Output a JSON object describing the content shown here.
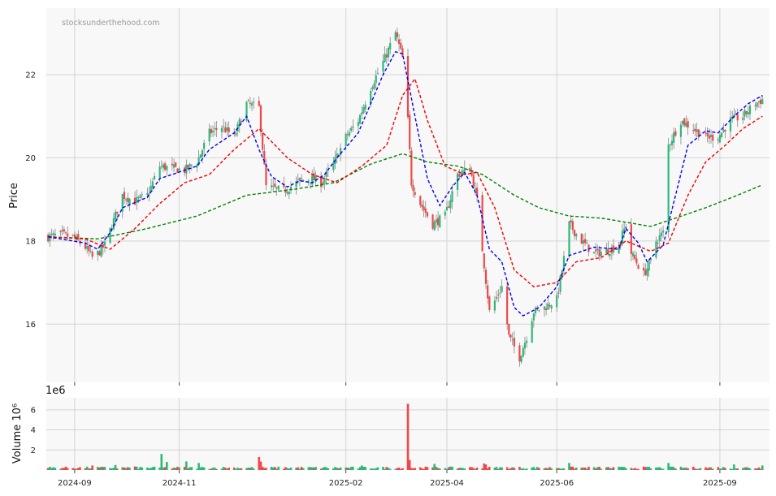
{
  "chart_data": [
    {
      "type": "candlestick",
      "panel": "price",
      "watermark": "stocksunderthehood.com",
      "ylabel": "Price",
      "ylim": [
        14.6,
        23.6
      ],
      "yticks": [
        16,
        18,
        20,
        22
      ],
      "xlim": [
        "2024-08-18",
        "2025-09-30"
      ],
      "grid": true,
      "colors": {
        "up": "#2db87a",
        "down": "#f04848",
        "ma_fast": "#0000ee",
        "ma_mid": "#ee0000",
        "ma_slow": "#008000",
        "background": "#f8f8f8",
        "grid": "#d4d4d4"
      },
      "anchors": [
        [
          "2024-08-19",
          18.1
        ],
        [
          "2024-08-26",
          18.15
        ],
        [
          "2024-09-02",
          18.1
        ],
        [
          "2024-09-09",
          17.85
        ],
        [
          "2024-09-13",
          17.6
        ],
        [
          "2024-09-16",
          17.7
        ],
        [
          "2024-09-20",
          17.9
        ],
        [
          "2024-09-25",
          18.5
        ],
        [
          "2024-09-30",
          19.1
        ],
        [
          "2024-10-07",
          18.95
        ],
        [
          "2024-10-14",
          19.1
        ],
        [
          "2024-10-21",
          19.8
        ],
        [
          "2024-10-28",
          19.75
        ],
        [
          "2024-11-04",
          19.7
        ],
        [
          "2024-11-11",
          19.9
        ],
        [
          "2024-11-18",
          20.6
        ],
        [
          "2024-11-25",
          20.75
        ],
        [
          "2024-12-02",
          20.5
        ],
        [
          "2024-12-09",
          21.3
        ],
        [
          "2024-12-16",
          21.2
        ],
        [
          "2024-12-20",
          19.3
        ],
        [
          "2024-12-30",
          19.2
        ],
        [
          "2025-01-08",
          19.45
        ],
        [
          "2025-01-15",
          19.5
        ],
        [
          "2025-01-20",
          19.4
        ],
        [
          "2025-01-27",
          19.85
        ],
        [
          "2025-02-03",
          20.5
        ],
        [
          "2025-02-10",
          20.9
        ],
        [
          "2025-02-17",
          21.7
        ],
        [
          "2025-02-24",
          22.3
        ],
        [
          "2025-03-03",
          23.0
        ],
        [
          "2025-03-07",
          22.4
        ],
        [
          "2025-03-10",
          20.9
        ],
        [
          "2025-03-12",
          19.4
        ],
        [
          "2025-03-17",
          18.9
        ],
        [
          "2025-03-24",
          18.4
        ],
        [
          "2025-03-31",
          18.6
        ],
        [
          "2025-04-07",
          19.6
        ],
        [
          "2025-04-14",
          19.75
        ],
        [
          "2025-04-18",
          19.0
        ],
        [
          "2025-04-21",
          17.8
        ],
        [
          "2025-04-25",
          16.3
        ],
        [
          "2025-05-02",
          16.9
        ],
        [
          "2025-05-06",
          15.7
        ],
        [
          "2025-05-12",
          15.2
        ],
        [
          "2025-05-16",
          15.7
        ],
        [
          "2025-05-20",
          16.3
        ],
        [
          "2025-05-26",
          16.4
        ],
        [
          "2025-06-02",
          16.6
        ],
        [
          "2025-06-05",
          17.3
        ],
        [
          "2025-06-09",
          18.4
        ],
        [
          "2025-06-16",
          18.0
        ],
        [
          "2025-06-23",
          17.7
        ],
        [
          "2025-06-30",
          17.75
        ],
        [
          "2025-07-07",
          17.9
        ],
        [
          "2025-07-11",
          18.4
        ],
        [
          "2025-07-14",
          17.7
        ],
        [
          "2025-07-21",
          17.2
        ],
        [
          "2025-07-25",
          17.5
        ],
        [
          "2025-07-28",
          18.0
        ],
        [
          "2025-08-01",
          18.2
        ],
        [
          "2025-08-04",
          20.3
        ],
        [
          "2025-08-11",
          20.9
        ],
        [
          "2025-08-18",
          20.7
        ],
        [
          "2025-08-25",
          20.5
        ],
        [
          "2025-09-01",
          20.5
        ],
        [
          "2025-09-08",
          20.9
        ],
        [
          "2025-09-15",
          21.0
        ],
        [
          "2025-09-22",
          21.3
        ],
        [
          "2025-09-26",
          21.4
        ]
      ],
      "ma_fast": [
        [
          "2024-08-19",
          18.1
        ],
        [
          "2024-09-09",
          17.95
        ],
        [
          "2024-09-16",
          17.8
        ],
        [
          "2024-09-23",
          18.2
        ],
        [
          "2024-09-30",
          18.8
        ],
        [
          "2024-10-14",
          19.05
        ],
        [
          "2024-10-21",
          19.5
        ],
        [
          "2024-11-04",
          19.7
        ],
        [
          "2024-11-11",
          19.8
        ],
        [
          "2024-11-18",
          20.2
        ],
        [
          "2024-12-02",
          20.6
        ],
        [
          "2024-12-09",
          21.0
        ],
        [
          "2024-12-16",
          20.2
        ],
        [
          "2024-12-23",
          19.55
        ],
        [
          "2025-01-01",
          19.3
        ],
        [
          "2025-01-08",
          19.45
        ],
        [
          "2025-01-15",
          19.4
        ],
        [
          "2025-01-22",
          19.6
        ],
        [
          "2025-01-29",
          20.0
        ],
        [
          "2025-02-10",
          20.6
        ],
        [
          "2025-02-17",
          21.3
        ],
        [
          "2025-02-24",
          22.0
        ],
        [
          "2025-03-03",
          22.55
        ],
        [
          "2025-03-07",
          22.5
        ],
        [
          "2025-03-14",
          21.0
        ],
        [
          "2025-03-21",
          19.5
        ],
        [
          "2025-03-28",
          18.85
        ],
        [
          "2025-04-04",
          19.3
        ],
        [
          "2025-04-11",
          19.65
        ],
        [
          "2025-04-18",
          19.1
        ],
        [
          "2025-04-25",
          17.8
        ],
        [
          "2025-05-02",
          17.5
        ],
        [
          "2025-05-09",
          16.4
        ],
        [
          "2025-05-14",
          16.2
        ],
        [
          "2025-05-23",
          16.4
        ],
        [
          "2025-06-02",
          16.9
        ],
        [
          "2025-06-09",
          17.65
        ],
        [
          "2025-06-23",
          17.85
        ],
        [
          "2025-07-07",
          17.8
        ],
        [
          "2025-07-11",
          18.3
        ],
        [
          "2025-07-18",
          17.95
        ],
        [
          "2025-07-23",
          17.5
        ],
        [
          "2025-08-01",
          17.9
        ],
        [
          "2025-08-08",
          19.1
        ],
        [
          "2025-08-15",
          20.3
        ],
        [
          "2025-08-25",
          20.65
        ],
        [
          "2025-09-01",
          20.6
        ],
        [
          "2025-09-10",
          21.0
        ],
        [
          "2025-09-18",
          21.3
        ],
        [
          "2025-09-26",
          21.5
        ]
      ],
      "ma_mid": [
        [
          "2024-08-19",
          18.1
        ],
        [
          "2024-09-09",
          18.05
        ],
        [
          "2024-09-23",
          17.8
        ],
        [
          "2024-10-07",
          18.3
        ],
        [
          "2024-10-21",
          18.9
        ],
        [
          "2024-11-04",
          19.4
        ],
        [
          "2024-11-18",
          19.6
        ],
        [
          "2024-12-02",
          20.2
        ],
        [
          "2024-12-16",
          20.7
        ],
        [
          "2025-01-01",
          20.0
        ],
        [
          "2025-01-15",
          19.6
        ],
        [
          "2025-01-29",
          19.4
        ],
        [
          "2025-02-12",
          19.8
        ],
        [
          "2025-02-26",
          20.3
        ],
        [
          "2025-03-07",
          21.5
        ],
        [
          "2025-03-14",
          21.9
        ],
        [
          "2025-03-21",
          20.9
        ],
        [
          "2025-03-31",
          19.8
        ],
        [
          "2025-04-11",
          19.6
        ],
        [
          "2025-04-18",
          19.65
        ],
        [
          "2025-04-28",
          18.8
        ],
        [
          "2025-05-09",
          17.3
        ],
        [
          "2025-05-20",
          16.9
        ],
        [
          "2025-06-02",
          17.0
        ],
        [
          "2025-06-13",
          17.5
        ],
        [
          "2025-06-27",
          17.6
        ],
        [
          "2025-07-11",
          18.0
        ],
        [
          "2025-07-25",
          17.75
        ],
        [
          "2025-08-04",
          17.95
        ],
        [
          "2025-08-15",
          19.1
        ],
        [
          "2025-08-25",
          19.9
        ],
        [
          "2025-09-05",
          20.3
        ],
        [
          "2025-09-15",
          20.7
        ],
        [
          "2025-09-26",
          21.0
        ]
      ],
      "ma_slow": [
        [
          "2024-08-19",
          18.1
        ],
        [
          "2024-09-16",
          18.05
        ],
        [
          "2024-10-14",
          18.3
        ],
        [
          "2024-11-11",
          18.6
        ],
        [
          "2024-12-09",
          19.1
        ],
        [
          "2025-01-06",
          19.25
        ],
        [
          "2025-01-27",
          19.4
        ],
        [
          "2025-02-17",
          19.85
        ],
        [
          "2025-03-07",
          20.1
        ],
        [
          "2025-03-21",
          19.9
        ],
        [
          "2025-04-07",
          19.8
        ],
        [
          "2025-04-21",
          19.6
        ],
        [
          "2025-05-09",
          19.1
        ],
        [
          "2025-05-23",
          18.8
        ],
        [
          "2025-06-09",
          18.6
        ],
        [
          "2025-06-27",
          18.55
        ],
        [
          "2025-07-11",
          18.45
        ],
        [
          "2025-07-25",
          18.35
        ],
        [
          "2025-08-08",
          18.55
        ],
        [
          "2025-08-25",
          18.8
        ],
        [
          "2025-09-12",
          19.1
        ],
        [
          "2025-09-26",
          19.35
        ]
      ]
    },
    {
      "type": "bar",
      "panel": "volume",
      "ylabel": "Volume  10⁶",
      "exponent_label": "1e6",
      "ylim": [
        0,
        7.2
      ],
      "yticks": [
        2,
        4,
        6
      ],
      "xticks": [
        "2024-09",
        "2024-11",
        "2025-02",
        "2025-04",
        "2025-06",
        "2025-09"
      ],
      "grid": true,
      "base_volume": 0.22,
      "spikes": [
        [
          "2024-09-13",
          0.45
        ],
        [
          "2024-09-26",
          0.5
        ],
        [
          "2024-10-07",
          0.35
        ],
        [
          "2024-10-22",
          1.6
        ],
        [
          "2024-10-25",
          0.8
        ],
        [
          "2024-11-05",
          0.85
        ],
        [
          "2024-11-12",
          0.7
        ],
        [
          "2024-12-16",
          1.3
        ],
        [
          "2024-12-17",
          0.85
        ],
        [
          "2025-02-12",
          0.45
        ],
        [
          "2025-03-10",
          6.6
        ],
        [
          "2025-03-11",
          1.0
        ],
        [
          "2025-03-25",
          0.6
        ],
        [
          "2025-04-22",
          0.65
        ],
        [
          "2025-04-23",
          0.55
        ],
        [
          "2025-06-09",
          0.7
        ],
        [
          "2025-08-04",
          0.7
        ],
        [
          "2025-09-10",
          0.55
        ],
        [
          "2025-09-26",
          0.45
        ]
      ]
    }
  ]
}
